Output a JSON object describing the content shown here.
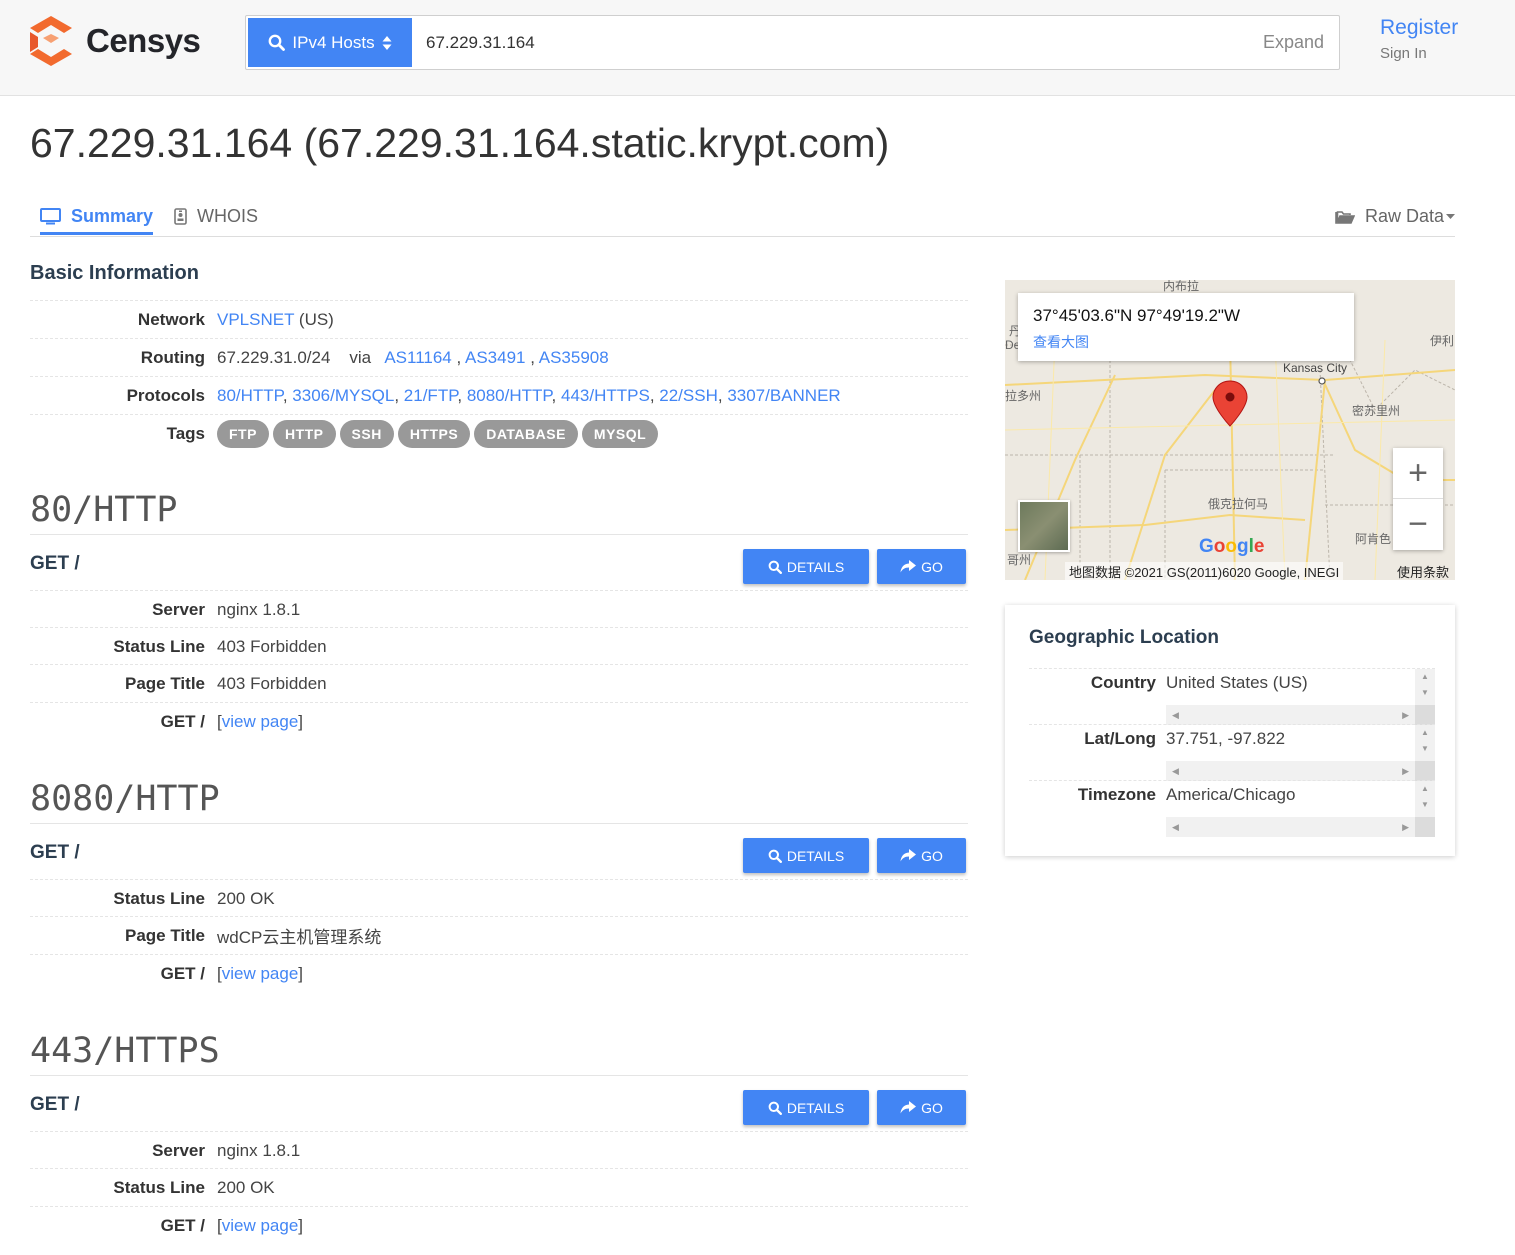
{
  "header": {
    "logo_text": "Censys",
    "search_type": "IPv4 Hosts",
    "search_value": "67.229.31.164",
    "expand_label": "Expand",
    "register_label": "Register",
    "signin_label": "Sign In"
  },
  "page_title": "67.229.31.164 (67.229.31.164.static.krypt.com)",
  "tabs": {
    "summary": "Summary",
    "whois": "WHOIS",
    "raw_data": "Raw Data"
  },
  "basic_info": {
    "heading": "Basic Information",
    "network_label": "Network",
    "network_name": "VPLSNET",
    "network_country": "(US)",
    "routing_label": "Routing",
    "routing_prefix": "67.229.31.0/24",
    "routing_via": "via",
    "asns": [
      "AS11164",
      "AS3491",
      "AS35908"
    ],
    "protocols_label": "Protocols",
    "protocols": [
      "80/HTTP",
      "3306/MYSQL",
      "21/FTP",
      "8080/HTTP",
      "443/HTTPS",
      "22/SSH",
      "3307/BANNER"
    ],
    "tags_label": "Tags",
    "tags": [
      "FTP",
      "HTTP",
      "SSH",
      "HTTPS",
      "DATABASE",
      "MYSQL"
    ]
  },
  "services": [
    {
      "title": "80/HTTP",
      "get": "GET /",
      "details_label": "DETAILS",
      "go_label": "GO",
      "rows": [
        {
          "label": "Server",
          "value": "nginx 1.8.1"
        },
        {
          "label": "Status Line",
          "value": "403 Forbidden"
        },
        {
          "label": "Page Title",
          "value": "403 Forbidden"
        }
      ],
      "view_label": "GET /",
      "view_link": "view page"
    },
    {
      "title": "8080/HTTP",
      "get": "GET /",
      "details_label": "DETAILS",
      "go_label": "GO",
      "rows": [
        {
          "label": "Status Line",
          "value": "200 OK"
        },
        {
          "label": "Page Title",
          "value": "wdCP云主机管理系统"
        }
      ],
      "view_label": "GET /",
      "view_link": "view page"
    },
    {
      "title": "443/HTTPS",
      "get": "GET /",
      "details_label": "DETAILS",
      "go_label": "GO",
      "rows": [
        {
          "label": "Server",
          "value": "nginx 1.8.1"
        },
        {
          "label": "Status Line",
          "value": "200 OK"
        }
      ],
      "view_label": "GET /",
      "view_link": "view page"
    }
  ],
  "map": {
    "coordinates": "37°45'03.6\"N 97°49'19.2\"W",
    "view_larger": "查看大图",
    "attribution": "地图数据 ©2021 GS(2011)6020 Google, INEGI",
    "terms": "使用条款",
    "google": "Google",
    "labels": [
      "内布拉",
      "Kansas City",
      "拉多州",
      "密苏里州",
      "俄克拉何马",
      "阿肯色",
      "哥州",
      "伊利",
      "De",
      "丹"
    ]
  },
  "geo": {
    "title": "Geographic Location",
    "rows": [
      {
        "label": "Country",
        "value": "United States (US)"
      },
      {
        "label": "Lat/Long",
        "value": "37.751, -97.822"
      },
      {
        "label": "Timezone",
        "value": "America/Chicago"
      }
    ]
  },
  "colors": {
    "accent": "#4285f4",
    "logo_orange": "#f26a2e",
    "tag_gray": "#999999",
    "heading_navy": "#2c3e50"
  }
}
